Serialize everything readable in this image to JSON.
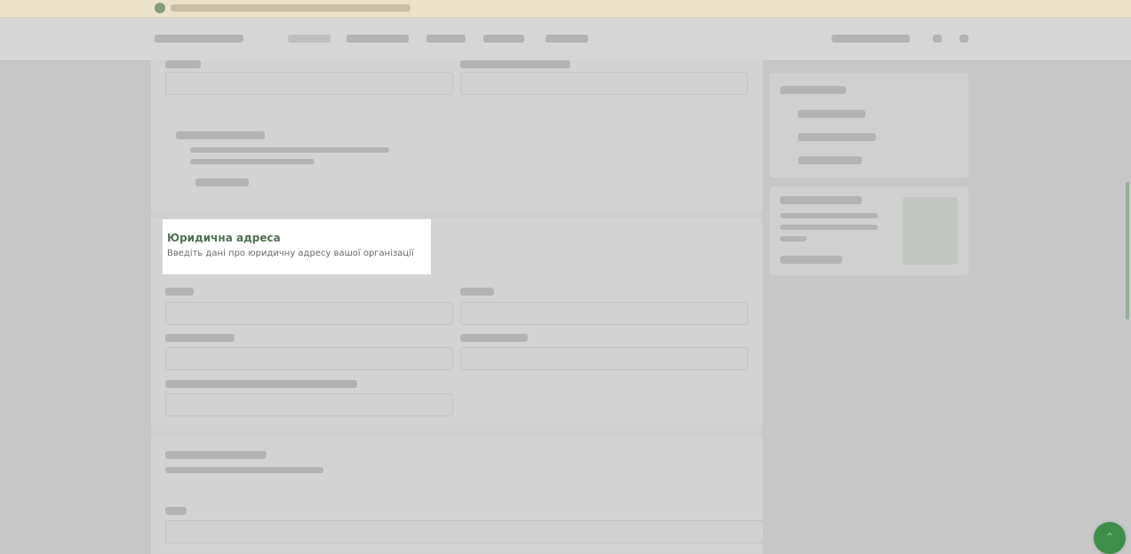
{
  "legal_address": {
    "title": "Юридична адреса",
    "subtitle": "Введіть дані про юридичну адресу вашої організації"
  },
  "colors": {
    "overlay": "#c7c7c7",
    "highlight_bg": "#ffffff",
    "title_green": "#4f7150",
    "fab_green": "#3e8e4a"
  },
  "fab": {
    "icon": "chevron-up-icon"
  }
}
